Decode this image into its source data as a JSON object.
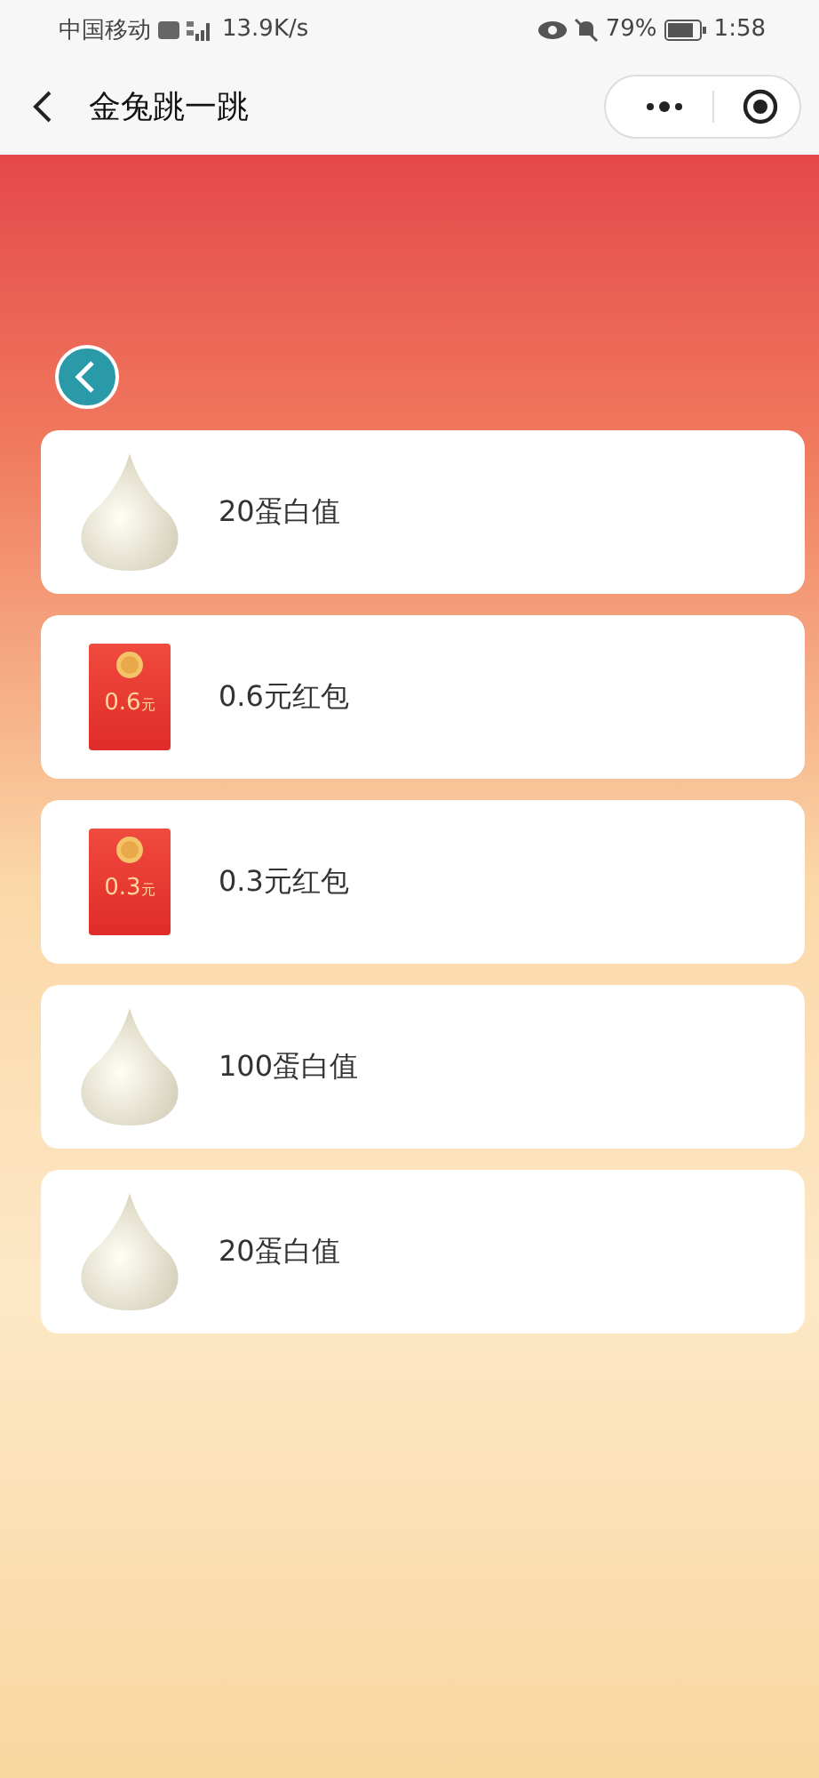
{
  "status_bar": {
    "carrier": "中国移动",
    "speed": "13.9K/s",
    "battery": "79%",
    "time": "1:58"
  },
  "nav": {
    "title": "金兔跳一跳"
  },
  "rewards": [
    {
      "kind": "drop",
      "label": "20蛋白值"
    },
    {
      "kind": "envelope",
      "amount": "0.6",
      "unit": "元",
      "label": "0.6元红包"
    },
    {
      "kind": "envelope",
      "amount": "0.3",
      "unit": "元",
      "label": "0.3元红包"
    },
    {
      "kind": "drop",
      "label": "100蛋白值"
    },
    {
      "kind": "drop",
      "label": "20蛋白值"
    }
  ]
}
